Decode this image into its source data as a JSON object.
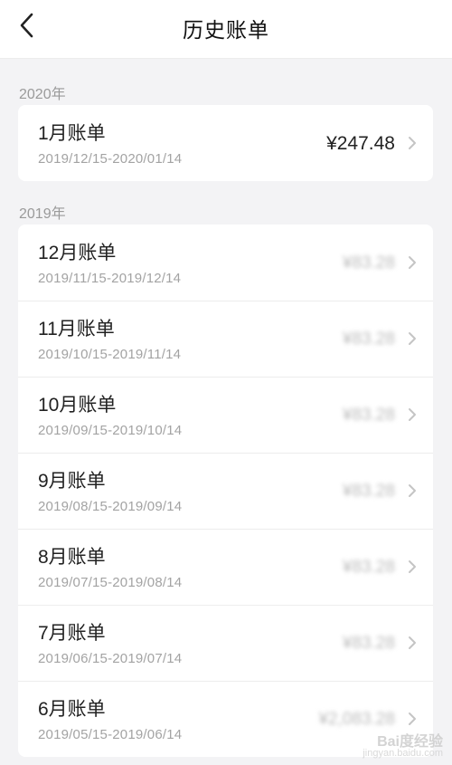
{
  "header": {
    "title": "历史账单",
    "back_icon": "chevron-left-icon"
  },
  "sections": [
    {
      "year_label": "2020年",
      "bills": [
        {
          "name": "1月账单",
          "range": "2019/12/15-2020/01/14",
          "amount": "¥247.48",
          "blurred": false
        }
      ]
    },
    {
      "year_label": "2019年",
      "bills": [
        {
          "name": "12月账单",
          "range": "2019/11/15-2019/12/14",
          "amount": "¥83.28",
          "blurred": true
        },
        {
          "name": "11月账单",
          "range": "2019/10/15-2019/11/14",
          "amount": "¥83.28",
          "blurred": true
        },
        {
          "name": "10月账单",
          "range": "2019/09/15-2019/10/14",
          "amount": "¥83.28",
          "blurred": true
        },
        {
          "name": "9月账单",
          "range": "2019/08/15-2019/09/14",
          "amount": "¥83.28",
          "blurred": true
        },
        {
          "name": "8月账单",
          "range": "2019/07/15-2019/08/14",
          "amount": "¥83.28",
          "blurred": true
        },
        {
          "name": "7月账单",
          "range": "2019/06/15-2019/07/14",
          "amount": "¥83.28",
          "blurred": true
        },
        {
          "name": "6月账单",
          "range": "2019/05/15-2019/06/14",
          "amount": "¥2,083.28",
          "blurred": true
        }
      ]
    }
  ],
  "watermark": {
    "brand": "Bai度经验",
    "url": "jingyan.baidu.com"
  },
  "colors": {
    "background": "#f3f3f5",
    "card": "#ffffff",
    "secondary_text": "#a3a3a3",
    "chevron": "#c4c4c4"
  }
}
